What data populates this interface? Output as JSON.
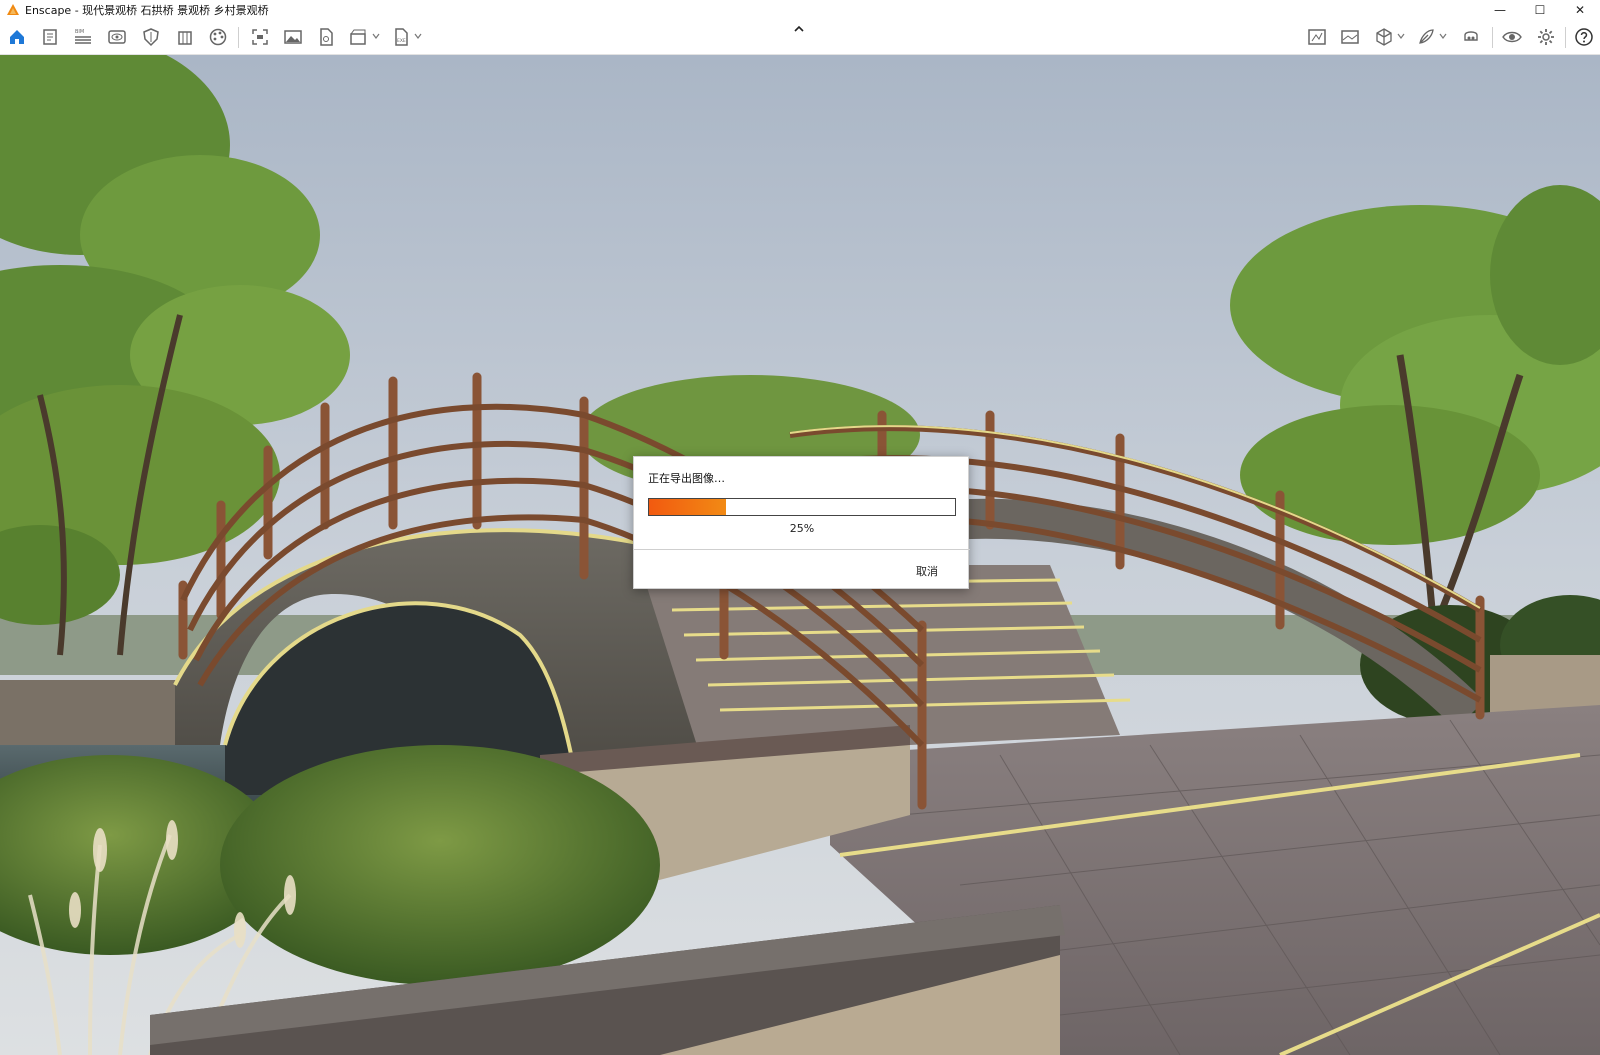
{
  "window": {
    "title": "Enscape - 现代景观桥 石拱桥 景观桥 乡村景观桥",
    "controls": {
      "minimize": "—",
      "maximize": "☐",
      "close": "✕"
    }
  },
  "toolbar": {
    "left_icons": [
      "home-icon",
      "document-icon",
      "bim-icon",
      "eye-box-icon",
      "shield-icon",
      "building-icon",
      "palette-icon",
      "screenshot-icon",
      "image-icon",
      "doc-export-icon",
      "video-icon",
      "exe-icon"
    ],
    "right_icons": [
      "map-icon",
      "panorama-icon",
      "cube-icon",
      "feather-icon",
      "vr-icon",
      "visibility-icon",
      "settings-icon",
      "help-icon"
    ],
    "bim_label": "BIM",
    "exe_label": "EXE"
  },
  "dialog": {
    "title": "正在导出图像…",
    "progress": 0.25,
    "progress_text": "25%",
    "cancel_label": "取消"
  },
  "colors": {
    "accent": "#1e78d7",
    "progress": "#f26d12",
    "logo": "#f08a12"
  }
}
